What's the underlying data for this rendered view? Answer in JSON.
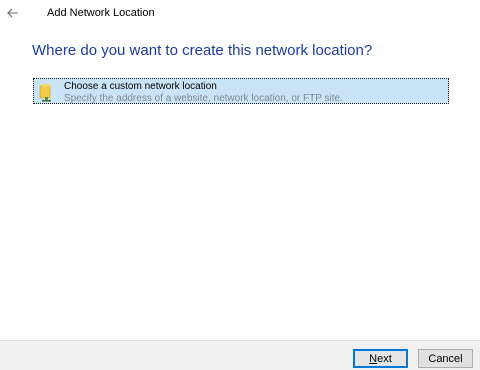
{
  "window": {
    "title": "Add Network Location",
    "back_icon": "back-arrow-icon"
  },
  "main": {
    "heading": "Where do you want to create this network location?",
    "options": [
      {
        "icon": "network-folder-icon",
        "title": "Choose a custom network location",
        "description": "Specify the address of a website, network location, or FTP site.",
        "selected": true
      }
    ]
  },
  "footer": {
    "next_mnemonic": "N",
    "next_rest": "ext",
    "cancel_label": "Cancel"
  },
  "colors": {
    "heading": "#1e3c96",
    "selection_bg": "#c9e4f7",
    "description_text": "#7a8a99",
    "focus_border": "#0078d7",
    "footer_bg": "#f0f0f0"
  }
}
